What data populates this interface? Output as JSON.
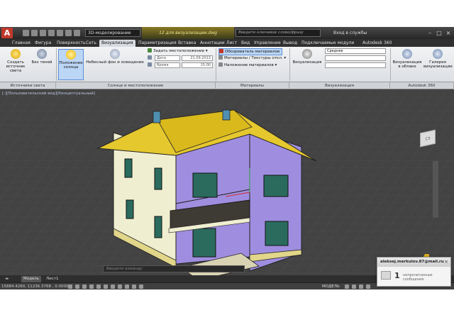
{
  "titlebar": {
    "workspace": "3D-моделирование",
    "file_title": "12 для визуализации.dwg",
    "search_placeholder": "Введите ключевое слово/фразу",
    "signin": "Вход в службы"
  },
  "ribbon_tabs": [
    "Главная",
    "Фигура",
    "Поверхность",
    "Сеть",
    "Визуализация",
    "Параметризация",
    "Вставка",
    "Аннотации",
    "Лист",
    "Вид",
    "Управление",
    "Вывод",
    "Подключаемые модули",
    "Autodesk 360"
  ],
  "active_tab": "Визуализация",
  "ribbon": {
    "create_light": "Создать источник света",
    "no_shadows": "Без теней",
    "sun_position": "Положение солнца",
    "sky_background": "Небесный фон и освещение",
    "set_location": "Задать местоположение",
    "date_field": "Дата",
    "date_value": "21.09.2013",
    "time_field": "Время",
    "time_value": "15:00",
    "material_browser": "Обозреватель материалов",
    "materials_textures": "Материалы / Текстуры откл.",
    "apply_materials": "Наложение материалов",
    "render": "Визуализация",
    "quality": "Среднее",
    "render_cloud": "Визуализация в облаке",
    "render_gallery": "Галерея визуализации"
  },
  "panel_labels": [
    "Источники света",
    "Солнце и местоположение",
    "Материалы",
    "Визуализация",
    "Autodesk 360"
  ],
  "viewport_label": "[-][Пользовательский вид][Концептуальный]",
  "viewcube_label": "СЗ",
  "command_placeholder": "Введите команду",
  "layout_tabs": [
    "Модель",
    "Лист1"
  ],
  "coords": "15884.4260, 11236.3768 , 0.0000",
  "model_label": "МОДЕЛЬ",
  "notification": {
    "user": "aleksej.merkulov.87@mail.ru",
    "count": "1",
    "text": "непрочитанные сообщения"
  },
  "colors": {
    "roof": "#e5c72e",
    "wall_white": "#efeed0",
    "wall_violet": "#9f8edf",
    "viewport_bg": "#434343",
    "ribbon_bg": "#e6e8eb"
  }
}
